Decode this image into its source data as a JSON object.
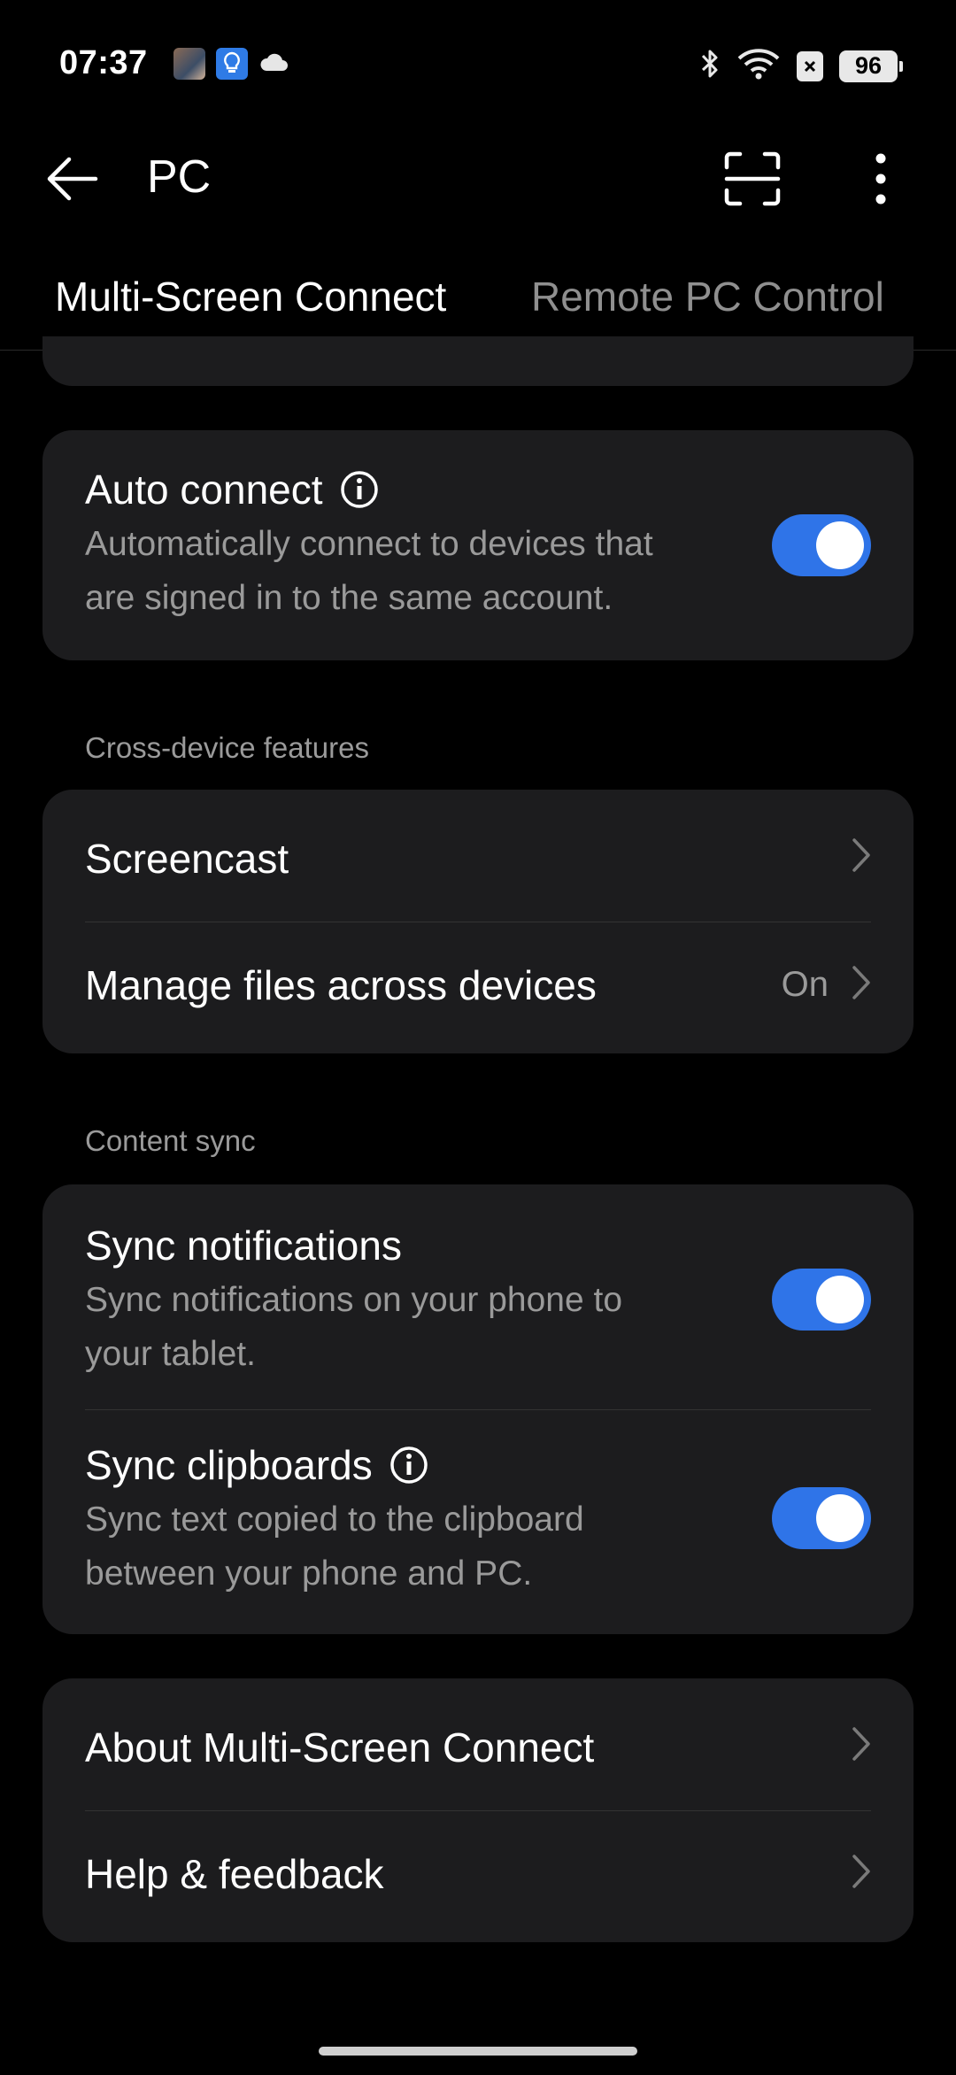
{
  "status_bar": {
    "time": "07:37",
    "battery": "96",
    "icons": [
      "game-thumbnail-icon",
      "lightbulb-icon",
      "cloud-icon",
      "bluetooth-icon",
      "wifi-icon",
      "sim-off-icon",
      "battery-icon"
    ]
  },
  "app_bar": {
    "title": "PC",
    "back_icon": "back-arrow-icon",
    "scan_icon": "scan-icon",
    "more_icon": "more-vertical-icon"
  },
  "tabs": [
    {
      "label": "Multi-Screen Connect",
      "active": true
    },
    {
      "label": "Remote PC Control",
      "active": false
    }
  ],
  "auto_connect": {
    "title": "Auto connect",
    "subtitle_line1": "Automatically connect to devices that",
    "subtitle_line2": "are signed in to the same account.",
    "enabled": true
  },
  "cross_device": {
    "header": "Cross-device features",
    "items": [
      {
        "label": "Screencast",
        "value": ""
      },
      {
        "label": "Manage files across devices",
        "value": "On"
      }
    ]
  },
  "content_sync": {
    "header": "Content sync",
    "items": [
      {
        "title": "Sync notifications",
        "subtitle_line1": "Sync notifications on your phone to",
        "subtitle_line2": "your tablet.",
        "enabled": true
      },
      {
        "title": "Sync clipboards",
        "subtitle_line1": "Sync text copied to the clipboard",
        "subtitle_line2": "between your phone and PC.",
        "enabled": true
      }
    ]
  },
  "about": {
    "items": [
      {
        "label": "About Multi-Screen Connect"
      },
      {
        "label": "Help & feedback"
      }
    ]
  },
  "colors": {
    "accent": "#2f74e8",
    "background": "#000000",
    "card": "#1c1c1e",
    "secondary_text": "#9a9a9a"
  }
}
